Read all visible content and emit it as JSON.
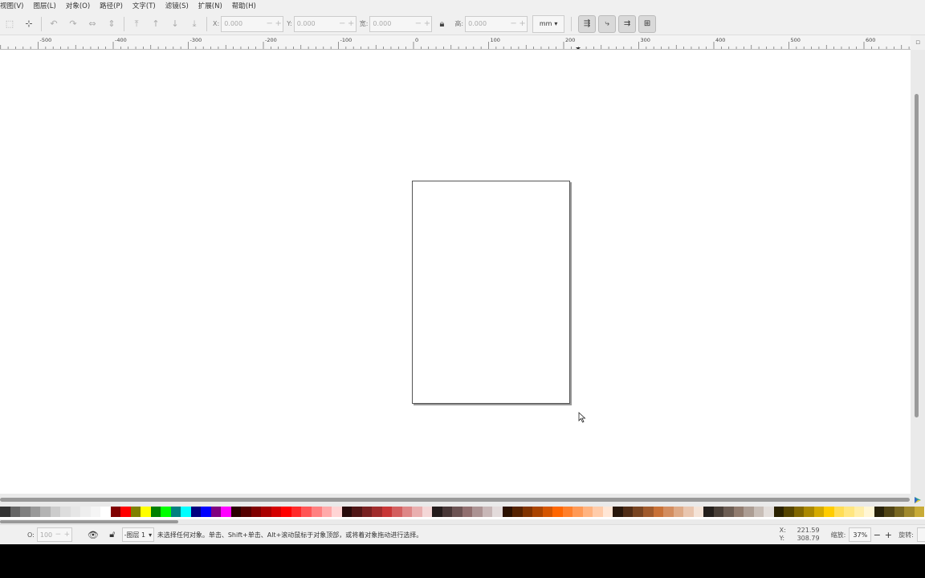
{
  "menubar": {
    "items": [
      "视图(V)",
      "图层(L)",
      "对象(O)",
      "路径(P)",
      "文字(T)",
      "滤镜(S)",
      "扩展(N)",
      "帮助(H)"
    ]
  },
  "toolbar": {
    "x_label": "X:",
    "x_value": "0.000",
    "y_label": "Y:",
    "y_value": "0.000",
    "w_label": "宽:",
    "w_value": "0.000",
    "h_label": "高:",
    "h_value": "0.000",
    "unit": "mm",
    "minus": "−",
    "plus": "+"
  },
  "ruler": {
    "labels": [
      "-500",
      "-400",
      "-300",
      "-200",
      "-100",
      "0",
      "100",
      "200",
      "300",
      "400",
      "500",
      "600"
    ]
  },
  "statusbar": {
    "opacity_label": "O:",
    "opacity_value": "100",
    "layer": "-图层 1",
    "message": "未选择任何对象。单击、Shift+单击、Alt+滚动鼠标于对象顶部，或将着对象拖动进行选择。",
    "x_label": "X:",
    "x_value": "221.59",
    "y_label": "Y:",
    "y_value": "308.79",
    "zoom_label": "缩放:",
    "zoom_value": "37%",
    "rotate_label": "旋转:"
  },
  "colors": {
    "accent": "#2c7be5",
    "palette": [
      "#333333",
      "#666666",
      "#808080",
      "#999999",
      "#b3b3b3",
      "#cccccc",
      "#dddddd",
      "#e6e6e6",
      "#eeeeee",
      "#f5f5f5",
      "#ffffff",
      "#800000",
      "#ff0000",
      "#808000",
      "#ffff00",
      "#008000",
      "#00ff00",
      "#008080",
      "#00ffff",
      "#000080",
      "#0000ff",
      "#800080",
      "#ff00ff",
      "#2b0000",
      "#550000",
      "#800000",
      "#aa0000",
      "#d40000",
      "#ff0000",
      "#ff2a2a",
      "#ff5555",
      "#ff8080",
      "#ffaaaa",
      "#ffd5d5",
      "#280b0b",
      "#501616",
      "#782121",
      "#a02c2c",
      "#c83737",
      "#d35f5f",
      "#de8787",
      "#e9afaf",
      "#f4d7d7",
      "#241c1c",
      "#483737",
      "#6c5353",
      "#916f6f",
      "#ac9393",
      "#c8b7b7",
      "#e3dbdb",
      "#2b1100",
      "#552200",
      "#803300",
      "#aa4400",
      "#d45500",
      "#ff6600",
      "#ff7f2a",
      "#ff9955",
      "#ffb380",
      "#ffccaa",
      "#ffe6d5",
      "#28170b",
      "#502d16",
      "#784421",
      "#a05a2c",
      "#c87137",
      "#d38d5f",
      "#deaa87",
      "#e9c6af",
      "#f4e3d7",
      "#241f1c",
      "#483e37",
      "#6c5d53",
      "#917c6f",
      "#ac9d93",
      "#c8beb7",
      "#e3dedb",
      "#2b2200",
      "#554400",
      "#806600",
      "#aa8800",
      "#d4aa00",
      "#ffcc00",
      "#ffdd55",
      "#ffe680",
      "#ffeeaa",
      "#fff6d5",
      "#28220b",
      "#504416",
      "#786721",
      "#a0892c",
      "#c8ab37"
    ]
  }
}
